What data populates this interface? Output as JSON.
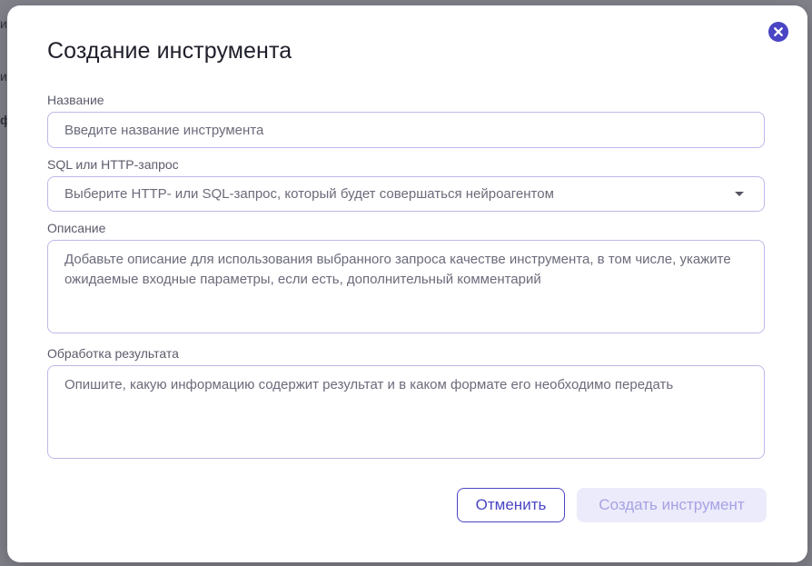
{
  "background": {
    "fragments": [
      "и",
      "и",
      "ф"
    ]
  },
  "modal": {
    "title": "Создание инструмента",
    "close_icon": "close-icon",
    "fields": {
      "name": {
        "label": "Название",
        "placeholder": "Введите название инструмента",
        "value": ""
      },
      "query": {
        "label": "SQL или HTTP-запрос",
        "placeholder": "Выберите HTTP- или SQL-запрос, который будет совершаться нейроагентом",
        "caret_icon": "caret-down-icon"
      },
      "description": {
        "label": "Описание",
        "placeholder": "Добавьте описание для использования выбранного запроса качестве инструмента, в том числе, укажите ожидаемые входные параметры, если есть, дополнительный комментарий",
        "value": ""
      },
      "result": {
        "label": "Обработка результата",
        "placeholder": "Опишите, какую информацию содержит результат и в каком формате его необходимо передать",
        "value": ""
      }
    },
    "buttons": {
      "cancel": "Отменить",
      "create": "Создать инструмент"
    }
  },
  "colors": {
    "accent": "#4a45c4",
    "border": "#bdb9ea",
    "disabled_bg": "#ecebfb",
    "disabled_text": "#a6a2e4"
  }
}
